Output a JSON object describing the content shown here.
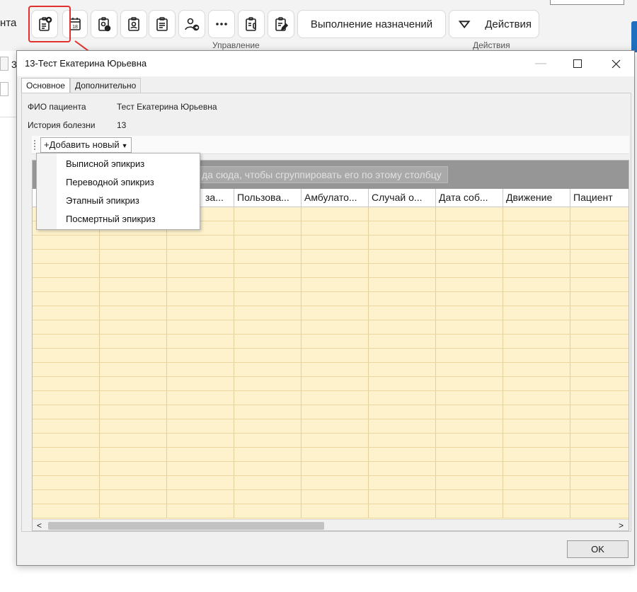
{
  "ribbon": {
    "left_text": "нта",
    "text_button": "Выполнение назначений",
    "actions_button": "Действия",
    "group_upravlenie": "Управление",
    "group_deystviya": "Действия",
    "left_stub_char": "3",
    "highlight_color": "#e03030"
  },
  "dialog": {
    "title": "13-Тест Екатерина Юрьевна",
    "tabs": [
      "Основное",
      "Дополнительно"
    ],
    "fields": {
      "fio_label": "ФИО пациента",
      "fio_value": "Тест Екатерина Юрьевна",
      "history_label": "История болезни",
      "history_value": "13"
    },
    "add_new_label": "+Добавить новый",
    "dropdown_items": [
      "Выписной эпикриз",
      "Переводной эпикриз",
      "Этапный эпикриз",
      "Посмертный эпикриз"
    ],
    "group_hint": "да сюда, чтобы сгруппировать его по этому столбцу",
    "columns": [
      "за...",
      "Пользова...",
      "Амбулато...",
      "Случай о...",
      "Дата соб...",
      "Движение",
      "Пациент"
    ],
    "ok_label": "OK",
    "grid_row_color": "#fdf2cc"
  }
}
